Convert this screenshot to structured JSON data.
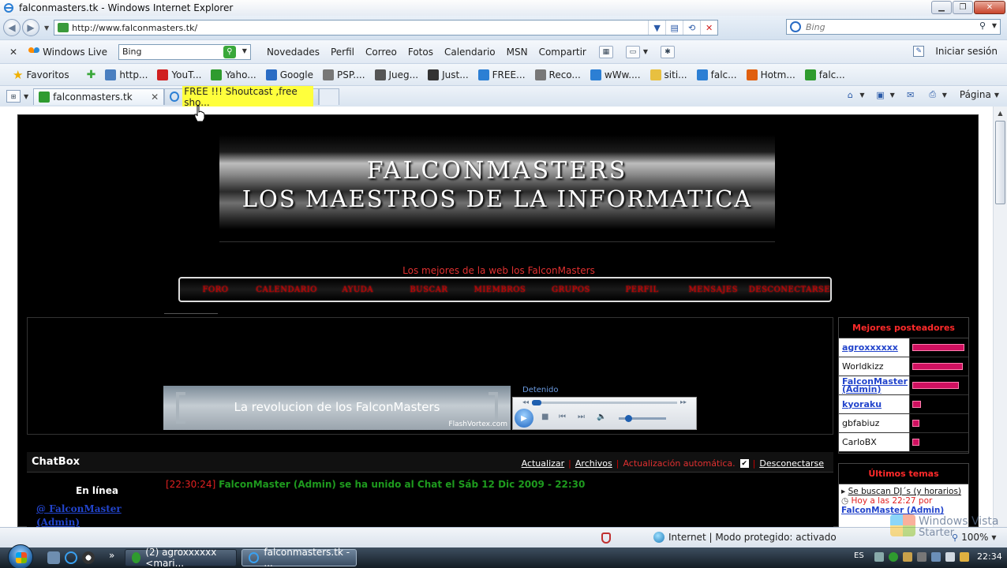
{
  "window": {
    "title": "falconmasters.tk - Windows Internet Explorer",
    "minimize": "▁",
    "maximize": "❐",
    "close": "✕"
  },
  "address_bar": {
    "url": "http://www.falconmasters.tk/",
    "search_placeholder": "Bing"
  },
  "live_toolbar": {
    "brand": "Windows Live",
    "search_value": "Bing",
    "links": [
      "Novedades",
      "Perfil",
      "Correo",
      "Fotos",
      "Calendario",
      "MSN",
      "Compartir"
    ],
    "signin": "Iniciar sesión"
  },
  "favorites_bar": {
    "label": "Favoritos",
    "items": [
      {
        "label": "http...",
        "icon": "page-icon",
        "color": "#4a7fc0"
      },
      {
        "label": "YouT...",
        "icon": "youtube-icon",
        "color": "#d02020"
      },
      {
        "label": "Yaho...",
        "icon": "yahoo-icon",
        "color": "#2f9b2f"
      },
      {
        "label": "Google",
        "icon": "google-icon",
        "color": "#2a6cc4"
      },
      {
        "label": "PSP....",
        "icon": "psp-icon",
        "color": "#777777"
      },
      {
        "label": "Jueg...",
        "icon": "games-icon",
        "color": "#555555"
      },
      {
        "label": "Just...",
        "icon": "itv-icon",
        "color": "#333333"
      },
      {
        "label": "FREE...",
        "icon": "ie-page-icon",
        "color": "#2c7fd4"
      },
      {
        "label": "Reco...",
        "icon": "tools-icon",
        "color": "#777777"
      },
      {
        "label": "wWw....",
        "icon": "ie-page-icon",
        "color": "#2c7fd4"
      },
      {
        "label": "siti...",
        "icon": "folder-icon",
        "color": "#e8c040"
      },
      {
        "label": "falc...",
        "icon": "ie-page-icon",
        "color": "#2c7fd4"
      },
      {
        "label": "Hotm...",
        "icon": "hotmail-icon",
        "color": "#e06010"
      },
      {
        "label": "falc...",
        "icon": "page-icon",
        "color": "#2f9b2f"
      }
    ]
  },
  "tabs": [
    {
      "label": "falconmasters.tk",
      "active": true
    },
    {
      "label": "FREE !!! Shoutcast ,free sho...",
      "active": false
    }
  ],
  "command_bar": {
    "page": "Página"
  },
  "site": {
    "banner_line1": "FALCONMASTERS",
    "banner_line2": "LOS MAESTROS DE LA INFORMATICA",
    "tagline": "Los mejores de la web los FalconMasters",
    "nav": [
      "FORO",
      "CALENDARIO",
      "AYUDA",
      "BUSCAR",
      "MIEMBROS",
      "GRUPOS",
      "PERFIL",
      "MENSAJES",
      "DESCONECTARSE"
    ],
    "flash_banner_text": "La revolucion de los FalconMasters",
    "flash_credit": "FlashVortex.com",
    "player_status": "Detenido",
    "posters": {
      "title": "Mejores posteadores",
      "rows": [
        {
          "name": "agroxxxxxx",
          "link": true,
          "fill": 1.0
        },
        {
          "name": "Worldkizz",
          "link": false,
          "fill": 0.97
        },
        {
          "name": "FalconMaster (Admin)",
          "link": true,
          "fill": 0.9
        },
        {
          "name": "kyoraku",
          "link": true,
          "fill": 0.17
        },
        {
          "name": "gbfabiuz",
          "link": false,
          "fill": 0.14
        },
        {
          "name": "CarloBX",
          "link": false,
          "fill": 0.14
        }
      ]
    },
    "topics": {
      "title": "Últimos temas",
      "first_link": "Se buscan DJ´s (y horarios)",
      "first_meta": "Hoy a las 22:27 por",
      "first_author": "FalconMaster (Admin)"
    },
    "chatbox": {
      "title": "ChatBox",
      "update": "Actualizar",
      "archives": "Archivos",
      "auto_update": "Actualización automática.",
      "disconnect": "Desconectarse",
      "online_label": "En línea",
      "online_user": "@ FalconMaster (Admin)",
      "message_time": "[22:30:24]",
      "message_text": "FalconMaster (Admin) se ha unido al Chat el Sáb 12 Dic 2009 - 22:30"
    }
  },
  "status_bar": {
    "zone": "Internet | Modo protegido: activado",
    "zoom": "100%",
    "watermark_line1": "Windows Vista",
    "watermark_line2": "Starter"
  },
  "taskbar": {
    "buttons": [
      "(2) agroxxxxxx <mari...",
      "falconmasters.tk - ..."
    ],
    "language": "ES",
    "clock": "22:34"
  }
}
